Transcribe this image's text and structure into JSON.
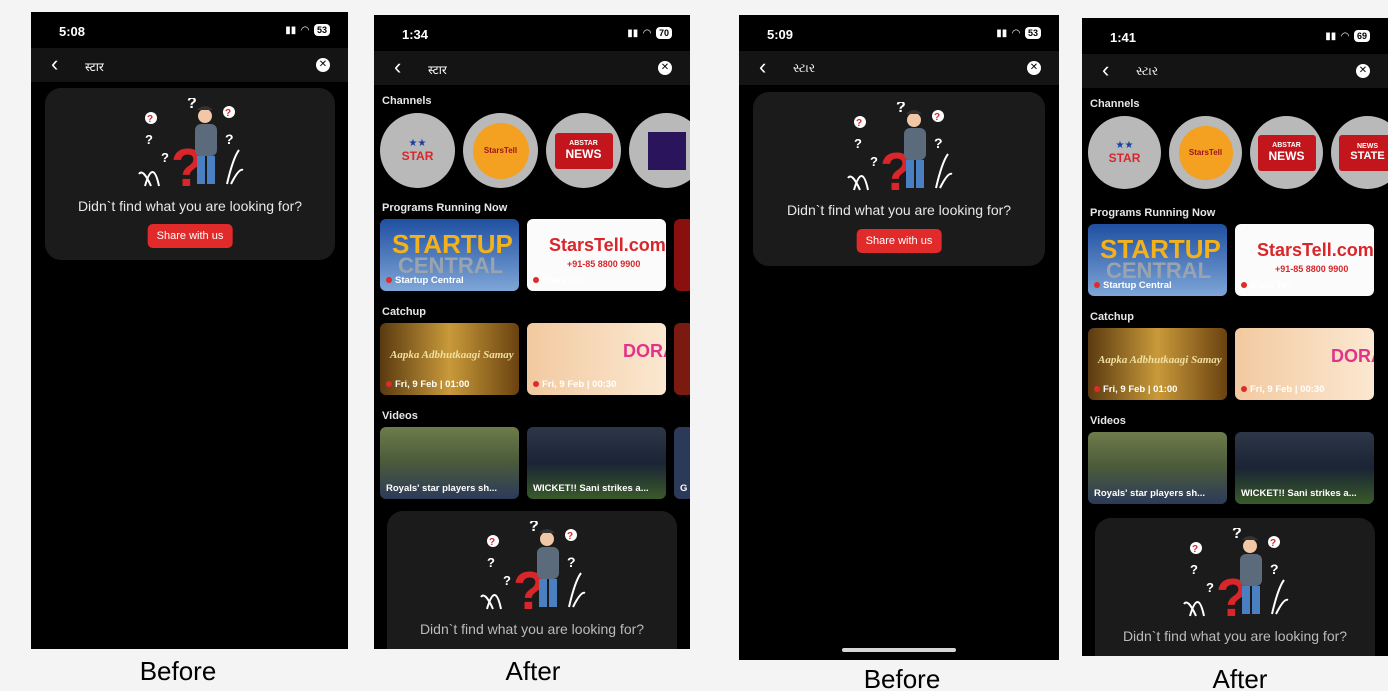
{
  "captions": {
    "before": "Before",
    "after": "After"
  },
  "screens": [
    {
      "time": "5:08",
      "battery": "53",
      "query": "स्टार",
      "empty_message": "Didn`t find what you are looking for?",
      "share_label": "Share with us"
    },
    {
      "time": "1:34",
      "battery": "70",
      "query": "स्टार",
      "sections": {
        "channels": "Channels",
        "programs": "Programs Running Now",
        "catchup": "Catchup",
        "videos": "Videos"
      },
      "channels": [
        {
          "logo": "STAR",
          "sub": "",
          "bg": "#d9d9d9"
        },
        {
          "logo": "StarsTell",
          "sub": "",
          "bg": "#f4a020"
        },
        {
          "logo": "NEWS",
          "sub": "ABSTAR",
          "bg": "#c3161c"
        },
        {
          "logo": "",
          "sub": "",
          "bg": "#2a145c"
        }
      ],
      "programs": [
        {
          "title_top": "STARTUP",
          "title_bottom": "CENTRAL",
          "label": "Startup Central"
        },
        {
          "title_top": "StarsTell.com",
          "title_bottom": "+91-85 8800 9900",
          "label": "Stars Tell"
        }
      ],
      "catchup": [
        {
          "title": "Aapka Adbhutkaagi Samay",
          "label": "Fri, 9 Feb | 01:00"
        },
        {
          "title": "DORA",
          "label": "Fri, 9 Feb | 00:30"
        }
      ],
      "videos": [
        {
          "label": "Royals' star players sh..."
        },
        {
          "label": "WICKET!! Sani strikes a..."
        },
        {
          "label": "G"
        }
      ],
      "empty_message_partial": "Didn`t find what you are looking for?"
    },
    {
      "time": "5:09",
      "battery": "53",
      "query": "સ્ટાર",
      "empty_message": "Didn`t find what you are looking for?",
      "share_label": "Share with us"
    },
    {
      "time": "1:41",
      "battery": "69",
      "query": "સ્ટાર",
      "sections": {
        "channels": "Channels",
        "programs": "Programs Running Now",
        "catchup": "Catchup",
        "videos": "Videos"
      },
      "channels": [
        {
          "logo": "STAR",
          "sub": "",
          "bg": "#d9d9d9"
        },
        {
          "logo": "StarsTell",
          "sub": "",
          "bg": "#f4a020"
        },
        {
          "logo": "NEWS",
          "sub": "ABSTAR",
          "bg": "#c3161c"
        },
        {
          "logo": "STATE",
          "sub": "NEWS",
          "bg": "#c3161c"
        }
      ],
      "programs": [
        {
          "title_top": "STARTUP",
          "title_bottom": "CENTRAL",
          "label": "Startup Central"
        },
        {
          "title_top": "StarsTell.com",
          "title_bottom": "+91-85 8800 9900",
          "label": "Stars Tell"
        }
      ],
      "catchup": [
        {
          "title": "Aapka Adbhutkaagi Samay",
          "label": "Fri, 9 Feb | 01:00"
        },
        {
          "title": "DORA",
          "label": "Fri, 9 Feb | 00:30"
        }
      ],
      "videos": [
        {
          "label": "Royals' star players sh..."
        },
        {
          "label": "WICKET!! Sani strikes a..."
        }
      ],
      "empty_message_partial": "Didn`t find what you are looking for?"
    }
  ],
  "icons": {
    "back": "chevron-left-icon",
    "clear": "close-circle-icon",
    "wifi": "wifi-icon",
    "signal": "signal-icon"
  },
  "colors": {
    "accent": "#e12a2a",
    "background": "#000000",
    "card": "#1b1b1b"
  }
}
